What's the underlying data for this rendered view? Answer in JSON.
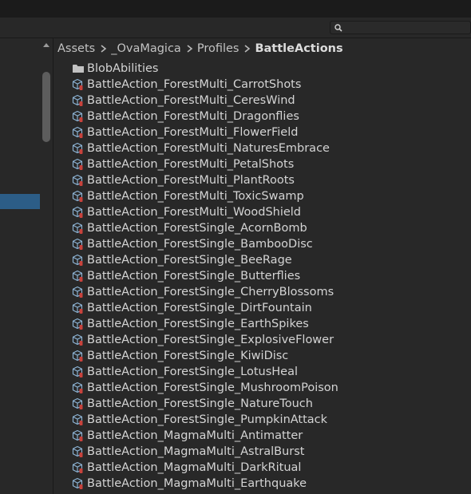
{
  "breadcrumb": [
    "Assets",
    "_OvaMagica",
    "Profiles",
    "BattleActions"
  ],
  "folders": [
    {
      "name": "BlobAbilities",
      "icon": "folder-icon"
    }
  ],
  "files": [
    "BattleAction_ForestMulti_CarrotShots",
    "BattleAction_ForestMulti_CeresWind",
    "BattleAction_ForestMulti_Dragonflies",
    "BattleAction_ForestMulti_FlowerField",
    "BattleAction_ForestMulti_NaturesEmbrace",
    "BattleAction_ForestMulti_PetalShots",
    "BattleAction_ForestMulti_PlantRoots",
    "BattleAction_ForestMulti_ToxicSwamp",
    "BattleAction_ForestMulti_WoodShield",
    "BattleAction_ForestSingle_AcornBomb",
    "BattleAction_ForestSingle_BambooDisc",
    "BattleAction_ForestSingle_BeeRage",
    "BattleAction_ForestSingle_Butterflies",
    "BattleAction_ForestSingle_CherryBlossoms",
    "BattleAction_ForestSingle_DirtFountain",
    "BattleAction_ForestSingle_EarthSpikes",
    "BattleAction_ForestSingle_ExplosiveFlower",
    "BattleAction_ForestSingle_KiwiDisc",
    "BattleAction_ForestSingle_LotusHeal",
    "BattleAction_ForestSingle_MushroomPoison",
    "BattleAction_ForestSingle_NatureTouch",
    "BattleAction_ForestSingle_PumpkinAttack",
    "BattleAction_MagmaMulti_Antimatter",
    "BattleAction_MagmaMulti_AstralBurst",
    "BattleAction_MagmaMulti_DarkRitual",
    "BattleAction_MagmaMulti_Earthquake"
  ],
  "file_icon": "scriptable-object-icon",
  "colors": {
    "selection": "#2c5d87",
    "panel": "#282828",
    "text": "#d4d4d4"
  }
}
